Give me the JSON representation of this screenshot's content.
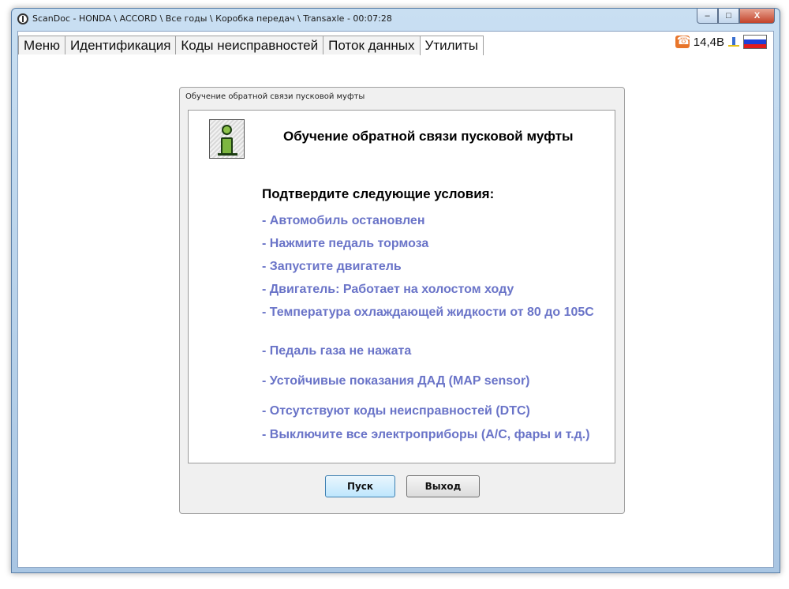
{
  "window": {
    "title": "ScanDoc - HONDA \\ ACCORD \\ Все годы \\ Коробка передач \\ Transaxle - 00:07:28",
    "controls": [
      "–",
      "□",
      "X"
    ]
  },
  "tabs": [
    {
      "label": "Меню",
      "active": false
    },
    {
      "label": "Идентификация",
      "active": false
    },
    {
      "label": "Коды неисправностей",
      "active": false
    },
    {
      "label": "Поток данных",
      "active": false
    },
    {
      "label": "Утилиты",
      "active": true
    }
  ],
  "status": {
    "voltage": "14,4В",
    "icons": [
      "phone-icon",
      "plug-icon",
      "russian-flag-icon"
    ],
    "flag_colors": [
      "#ffffff",
      "#1c3fd8",
      "#e21b1b"
    ],
    "accent": "#e8752a"
  },
  "dialog": {
    "caption": "Обучение обратной связи пусковой муфты",
    "heading": "Обучение обратной связи пусковой муфты",
    "conditions_title": "Подтвердите следующие условия:",
    "conditions": [
      "- Автомобиль остановлен",
      "- Нажмите педаль тормоза",
      "- Запустите двигатель",
      "- Двигатель: Работает на холостом ходу",
      "- Температура охлаждающей жидкости от 80 до 105С",
      "- Педаль газа не нажата",
      "- Устойчивые показания ДАД (MAP sensor)",
      "- Отсутствуют коды неисправностей (DTC)",
      "- Выключите все электроприборы (A/C, фары и т.д.)"
    ],
    "condition_color": "#6a74c8",
    "buttons": {
      "start": "Пуск",
      "exit": "Выход"
    }
  }
}
